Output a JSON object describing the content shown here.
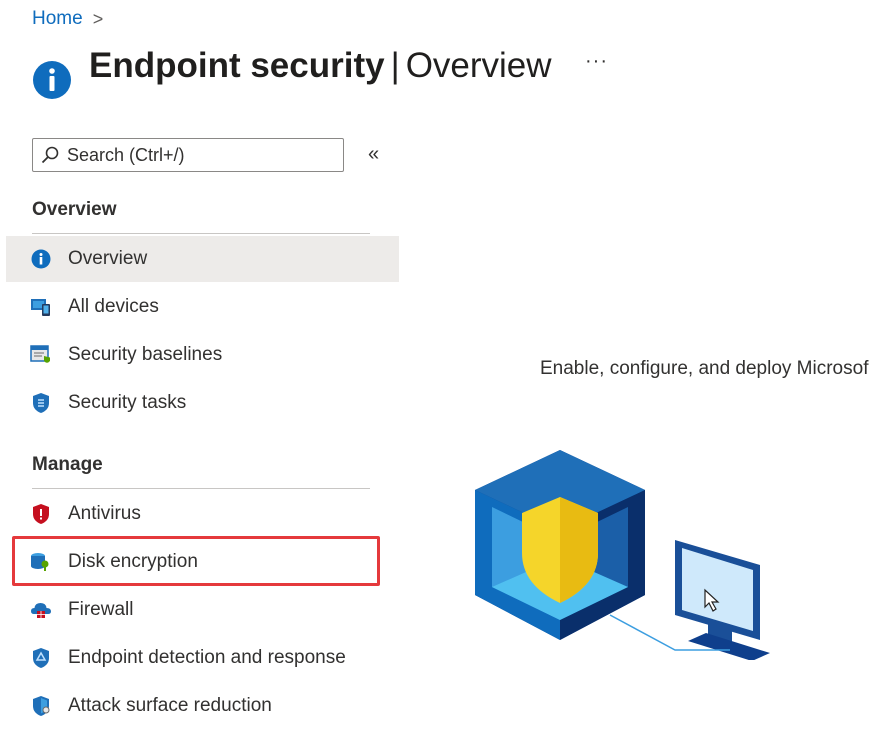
{
  "breadcrumb": {
    "home": "Home",
    "separator": ">"
  },
  "header": {
    "title_bold": "Endpoint security",
    "title_sep": "|",
    "title_rest": "Overview",
    "more": "···"
  },
  "search": {
    "placeholder": "Search (Ctrl+/)",
    "collapse": "«"
  },
  "sections": {
    "overview": "Overview",
    "manage": "Manage"
  },
  "nav_overview": [
    {
      "label": "Overview",
      "icon": "info-icon",
      "selected": true
    },
    {
      "label": "All devices",
      "icon": "devices-icon"
    },
    {
      "label": "Security baselines",
      "icon": "security-baselines-icon"
    },
    {
      "label": "Security tasks",
      "icon": "security-tasks-icon"
    }
  ],
  "nav_manage": [
    {
      "label": "Antivirus",
      "icon": "antivirus-shield-icon"
    },
    {
      "label": "Disk encryption",
      "icon": "disk-encryption-icon",
      "highlighted": true
    },
    {
      "label": "Firewall",
      "icon": "firewall-icon"
    },
    {
      "label": "Endpoint detection and response",
      "icon": "edr-icon"
    },
    {
      "label": "Attack surface reduction",
      "icon": "attack-surface-icon"
    }
  ],
  "main": {
    "tagline": "Enable, configure, and deploy Microsof"
  },
  "colors": {
    "accent": "#0f6cbd",
    "selected_bg": "#edebe9",
    "highlight_border": "#e5393c"
  }
}
